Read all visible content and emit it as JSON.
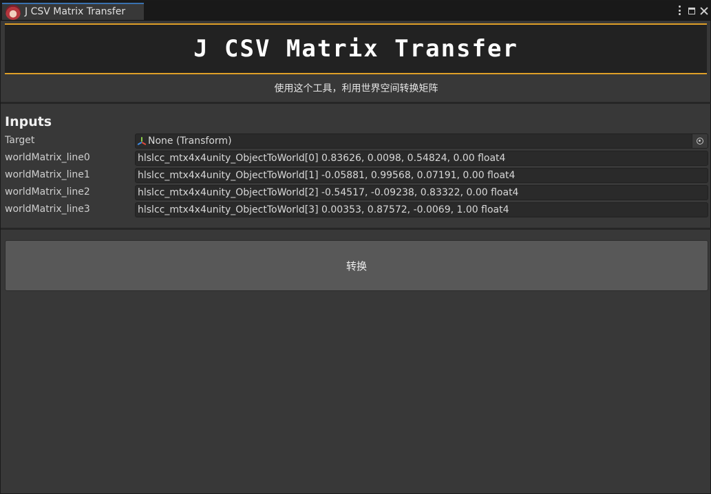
{
  "window": {
    "tab_title": "J CSV Matrix Transfer"
  },
  "header": {
    "title": "J CSV Matrix Transfer",
    "subtitle": "使用这个工具，利用世界空间转换矩阵",
    "accent_color": "#e0a028"
  },
  "inputs": {
    "section_title": "Inputs",
    "target": {
      "label": "Target",
      "value": "None (Transform)"
    },
    "rows": [
      {
        "label": "worldMatrix_line0",
        "value": "hlslcc_mtx4x4unity_ObjectToWorld[0] 0.83626, 0.0098, 0.54824, 0.00 float4"
      },
      {
        "label": "worldMatrix_line1",
        "value": "hlslcc_mtx4x4unity_ObjectToWorld[1] -0.05881, 0.99568, 0.07191, 0.00 float4"
      },
      {
        "label": "worldMatrix_line2",
        "value": "hlslcc_mtx4x4unity_ObjectToWorld[2] -0.54517, -0.09238, 0.83322, 0.00 float4"
      },
      {
        "label": "worldMatrix_line3",
        "value": "hlslcc_mtx4x4unity_ObjectToWorld[3] 0.00353, 0.87572, -0.0069, 1.00 float4"
      }
    ]
  },
  "actions": {
    "convert_label": "转换"
  },
  "icons": {
    "tab": "app-avatar-icon",
    "menu": "kebab-menu-icon",
    "maximize": "maximize-icon",
    "close": "close-icon",
    "target_type": "transform-icon",
    "picker": "object-picker-icon"
  }
}
